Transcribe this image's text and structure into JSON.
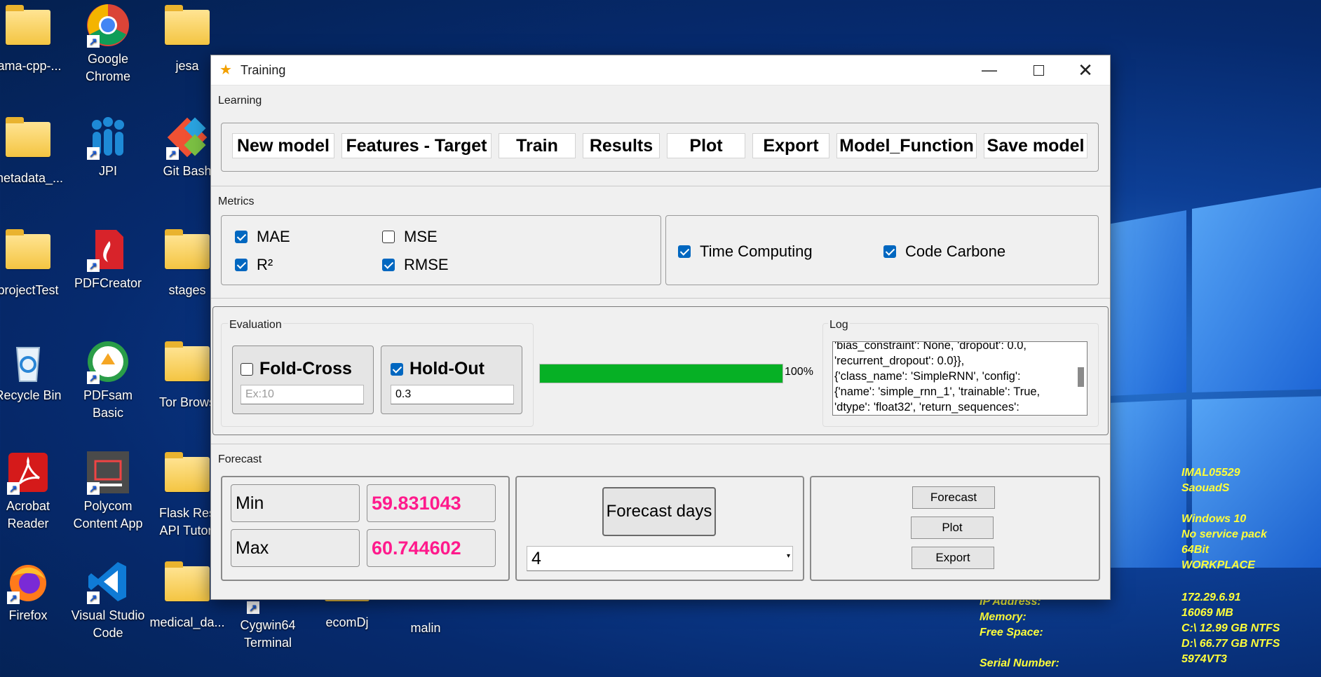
{
  "desktop": {
    "icons": [
      {
        "label": "lama-cpp-..."
      },
      {
        "label": "Google Chrome"
      },
      {
        "label": "jesa"
      },
      {
        "label": "metadata_..."
      },
      {
        "label": "JPI"
      },
      {
        "label": "Git Bash"
      },
      {
        "label": "projectTest"
      },
      {
        "label": "PDFCreator"
      },
      {
        "label": "stages"
      },
      {
        "label": "Recycle Bin"
      },
      {
        "label": "PDFsam Basic"
      },
      {
        "label": "Tor Brows"
      },
      {
        "label": "Acrobat Reader"
      },
      {
        "label": "Polycom Content App"
      },
      {
        "label": "Flask Res API Tutori"
      },
      {
        "label": "Firefox"
      },
      {
        "label": "Visual Studio Code"
      },
      {
        "label": "medical_da..."
      },
      {
        "label": "Cygwin64 Terminal"
      },
      {
        "label": "ecomDj"
      },
      {
        "label": "malin"
      }
    ]
  },
  "bginfo": {
    "left": "IP Address:\nMemory:\nFree Space:\n\nSerial Number:",
    "right": "IMAL05529\nSaouadS\n\nWindows 10\nNo service pack\n64Bit\nWORKPLACE",
    "right2": "172.29.6.91\n16069 MB\nC:\\ 12.99 GB NTFS\nD:\\ 66.77 GB NTFS\n5974VT3"
  },
  "window": {
    "title": "Training",
    "learning": {
      "label": "Learning",
      "buttons": [
        "New model",
        "Features - Target",
        "Train",
        "Results",
        "Plot",
        "Export",
        "Model_Function",
        "Save model"
      ]
    },
    "metrics": {
      "label": "Metrics",
      "mae": "MAE",
      "mse": "MSE",
      "r2": "R²",
      "rmse": "RMSE",
      "time_computing": "Time Computing",
      "code_carbone": "Code Carbone"
    },
    "evaluation": {
      "label": "Evaluation",
      "fold_cross": "Fold-Cross",
      "fold_placeholder": "Ex:10",
      "hold_out": "Hold-Out",
      "hold_value": "0.3",
      "progress": 1.0,
      "progress_text": "100%"
    },
    "log": {
      "label": "Log",
      "lines": [
        "'bias_constraint': None, 'dropout': 0.0,",
        "'recurrent_dropout': 0.0}},",
        "{'class_name': 'SimpleRNN', 'config':",
        "{'name': 'simple_rnn_1', 'trainable': True,",
        "'dtype': 'float32', 'return_sequences':"
      ]
    },
    "forecast": {
      "label": "Forecast",
      "min_label": "Min",
      "min_value": "59.831043",
      "max_label": "Max",
      "max_value": "60.744602",
      "days_label": "Forecast days",
      "days_value": "4",
      "forecast_btn": "Forecast",
      "plot_btn": "Plot",
      "export_btn": "Export"
    }
  },
  "colors": {
    "progress": "#06b025",
    "value": "#ff1a8c",
    "accent": "#0067c0"
  }
}
